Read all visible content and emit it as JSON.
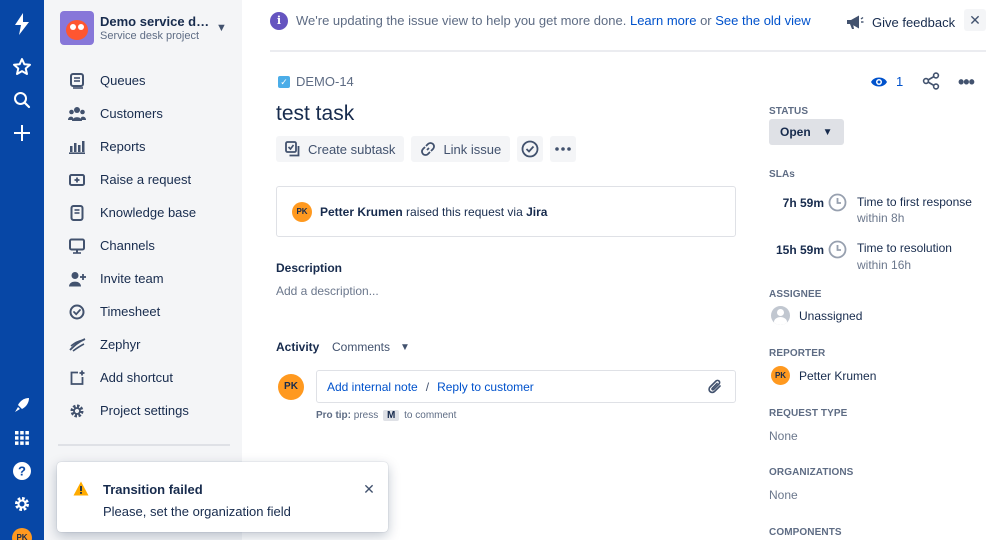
{
  "project": {
    "name": "Demo service de...",
    "type": "Service desk project"
  },
  "sidebar": {
    "items": [
      {
        "label": "Queues",
        "icon": "queues-icon"
      },
      {
        "label": "Customers",
        "icon": "customers-icon"
      },
      {
        "label": "Reports",
        "icon": "reports-icon"
      },
      {
        "label": "Raise a request",
        "icon": "raise-request-icon"
      },
      {
        "label": "Knowledge base",
        "icon": "knowledge-base-icon"
      },
      {
        "label": "Channels",
        "icon": "channels-icon"
      },
      {
        "label": "Invite team",
        "icon": "invite-team-icon"
      },
      {
        "label": "Timesheet",
        "icon": "timesheet-icon"
      },
      {
        "label": "Zephyr",
        "icon": "zephyr-icon"
      },
      {
        "label": "Add shortcut",
        "icon": "add-shortcut-icon"
      },
      {
        "label": "Project settings",
        "icon": "project-settings-icon"
      }
    ]
  },
  "global_nav": {
    "user_initials": "PK"
  },
  "banner": {
    "text": "We're updating the issue view to help you get more done.",
    "learn_more": "Learn more",
    "or": "or",
    "old_view": "See the old view",
    "feedback": "Give feedback",
    "close": "✕"
  },
  "issue": {
    "key": "DEMO-14",
    "title": "test task",
    "watchers": "1",
    "actions": {
      "create_subtask": "Create subtask",
      "link_issue": "Link issue"
    },
    "request": {
      "initials": "PK",
      "user": "Petter Krumen",
      "middle": "raised this request via",
      "channel": "Jira"
    },
    "description": {
      "label": "Description",
      "placeholder": "Add a description..."
    },
    "activity": {
      "label": "Activity",
      "filter": "Comments",
      "add_internal_note": "Add internal note",
      "separator": "/",
      "reply_to_customer": "Reply to customer",
      "protip_prefix": "Pro tip:",
      "protip_press": "press",
      "protip_key": "M",
      "protip_suffix": "to comment"
    }
  },
  "details": {
    "status_label": "STATUS",
    "status_value": "Open",
    "slas_label": "SLAs",
    "slas": [
      {
        "time": "7h 59m",
        "name": "Time to first response",
        "goal": "within 8h"
      },
      {
        "time": "15h 59m",
        "name": "Time to resolution",
        "goal": "within 16h"
      }
    ],
    "assignee_label": "ASSIGNEE",
    "assignee_value": "Unassigned",
    "reporter_label": "REPORTER",
    "reporter_initials": "PK",
    "reporter_value": "Petter Krumen",
    "request_type_label": "REQUEST TYPE",
    "request_type_value": "None",
    "organizations_label": "ORGANIZATIONS",
    "organizations_value": "None",
    "components_label": "COMPONENTS"
  },
  "toast": {
    "title": "Transition failed",
    "message": "Please, set the organization field",
    "close": "✕"
  },
  "colors": {
    "rail": "#0747a6",
    "link": "#0052cc",
    "warning": "#ffab00",
    "avatar_orange": "#ff991f"
  }
}
